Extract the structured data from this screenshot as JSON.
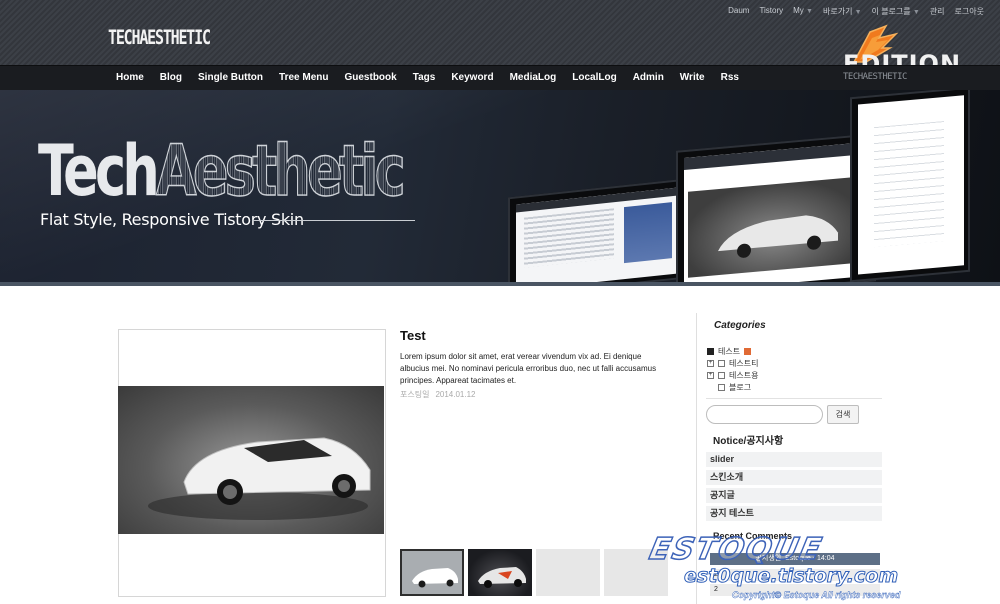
{
  "site": {
    "logo_text": "TECHAESTHETIC",
    "edition_text": "EDITION",
    "nav_logo_text": "TECHAESTHETIC"
  },
  "utility_links": [
    "Daum",
    "Tistory",
    "My",
    "바로가기",
    "이 블로그를",
    "관리",
    "로그아웃"
  ],
  "nav": [
    "Home",
    "Blog",
    "Single Button",
    "Tree Menu",
    "Guestbook",
    "Tags",
    "Keyword",
    "MediaLog",
    "LocalLog",
    "Admin",
    "Write",
    "Rss"
  ],
  "hero": {
    "title_part1": "Tech",
    "title_part2": "Aesthetic",
    "subtitle": "Flat Style, Responsive Tistory Skin"
  },
  "post": {
    "title": "Test",
    "body": "Lorem ipsum dolor sit amet, erat verear vivendum vix ad. Ei denique albucius mei. No nominavi pericula erroribus duo, nec ut falli accusamus principes. Appareat tacimates et.",
    "date_label": "포스팅일",
    "date": "2014.01.12"
  },
  "sidebar": {
    "categories_heading": "Categories",
    "categories": [
      {
        "label": "테스트",
        "level": 0
      },
      {
        "label": "테스트티",
        "level": 1
      },
      {
        "label": "테스트용",
        "level": 1
      },
      {
        "label": "블로그",
        "level": 1
      }
    ],
    "search_button": "검색",
    "notice_heading": "Notice/공지사항",
    "notices": [
      "slider",
      "스킨소개",
      "공지글",
      "공지 테스트"
    ],
    "recent_heading": "Recent Comments",
    "recent_comments": [
      "공지생인..Estoque - 14:04",
      "2",
      "2"
    ]
  },
  "watermark": {
    "brand": "ESTOQUE",
    "site": "est0que.tistory.com",
    "copyright": "Copyright© Estoque All rights reserved"
  }
}
